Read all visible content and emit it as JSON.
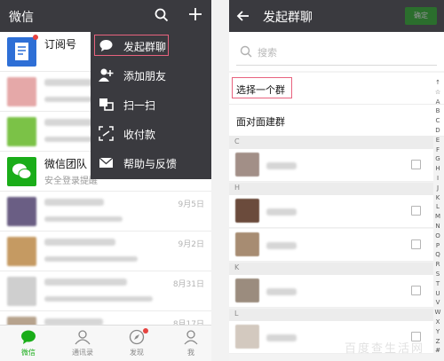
{
  "left": {
    "title": "微信",
    "chats": [
      {
        "name": "订阅号",
        "preview": "",
        "time": "",
        "unread": true,
        "avatar_color": "#2e6fd6",
        "icon": "document-icon"
      },
      {
        "name": "",
        "preview": "",
        "time": "",
        "unread": false,
        "avatar_color": "#e5a8a8",
        "icon": ""
      },
      {
        "name": "",
        "preview": "",
        "time": "",
        "unread": false,
        "avatar_color": "#7bc247",
        "icon": ""
      },
      {
        "name": "微信团队",
        "preview": "安全登录提醒",
        "time": "",
        "unread": false,
        "avatar_color": "#1aad19",
        "icon": "wechat-logo-icon"
      },
      {
        "name": "",
        "preview": "",
        "time": "9月5日",
        "unread": false,
        "avatar_color": "#6a5e84",
        "icon": ""
      },
      {
        "name": "",
        "preview": "",
        "time": "9月2日",
        "unread": false,
        "avatar_color": "#c59a62",
        "icon": ""
      },
      {
        "name": "",
        "preview": "",
        "time": "8月31日",
        "unread": false,
        "avatar_color": "#cfcfcf",
        "icon": ""
      },
      {
        "name": "",
        "preview": "",
        "time": "8月17日",
        "unread": false,
        "avatar_color": "#b7a38e",
        "icon": ""
      }
    ],
    "menu": [
      {
        "label": "发起群聊",
        "icon": "chat-bubble-icon"
      },
      {
        "label": "添加朋友",
        "icon": "add-friend-icon"
      },
      {
        "label": "扫一扫",
        "icon": "scan-icon"
      },
      {
        "label": "收付款",
        "icon": "payment-icon"
      },
      {
        "label": "帮助与反馈",
        "icon": "envelope-icon"
      }
    ],
    "tabs": [
      {
        "label": "微信",
        "icon": "chat-tab-icon",
        "active": true
      },
      {
        "label": "通讯录",
        "icon": "contacts-tab-icon",
        "active": false
      },
      {
        "label": "发现",
        "icon": "compass-tab-icon",
        "active": false
      },
      {
        "label": "我",
        "icon": "me-tab-icon",
        "active": false
      }
    ]
  },
  "right": {
    "title": "发起群聊",
    "done_label": "确定",
    "search_placeholder": "搜索",
    "option_select_group": "选择一个群",
    "option_face_to_face": "面对面建群",
    "sections": [
      {
        "letter": "C",
        "rows": [
          {
            "avatar_color": "#a28f87"
          }
        ]
      },
      {
        "letter": "H",
        "rows": [
          {
            "avatar_color": "#6b4b3c"
          },
          {
            "avatar_color": "#a78c72"
          }
        ]
      },
      {
        "letter": "K",
        "rows": [
          {
            "avatar_color": "#9b8c7e"
          }
        ]
      },
      {
        "letter": "L",
        "rows": [
          {
            "avatar_color": "#d3c9bf"
          }
        ]
      }
    ],
    "alphabet": [
      "↑",
      "☆",
      "A",
      "B",
      "C",
      "D",
      "E",
      "F",
      "G",
      "H",
      "I",
      "J",
      "K",
      "L",
      "M",
      "N",
      "O",
      "P",
      "Q",
      "R",
      "S",
      "T",
      "U",
      "V",
      "W",
      "X",
      "Y",
      "Z",
      "#"
    ]
  },
  "watermark": "百度查生活网",
  "colors": {
    "topbar": "#3a3a3f",
    "accent_green": "#1aad19",
    "highlight_box": "#e8637e",
    "badge_red": "#e64340"
  }
}
